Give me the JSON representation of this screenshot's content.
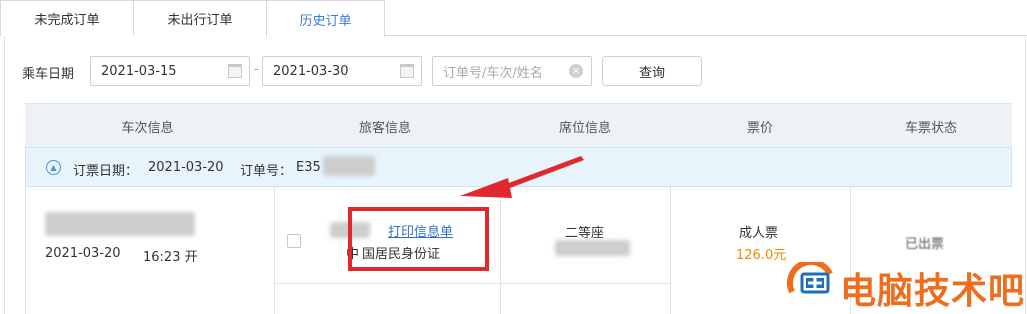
{
  "tabs": [
    {
      "label": "未完成订单"
    },
    {
      "label": "未出行订单"
    },
    {
      "label": "历史订单",
      "active": true
    }
  ],
  "filter": {
    "date_label": "乘车日期",
    "date_from": "2021-03-15",
    "date_sep": "-",
    "date_to": "2021-03-30",
    "search_placeholder": "订单号/车次/姓名",
    "query_button": "查询"
  },
  "table": {
    "headers": [
      "车次信息",
      "旅客信息",
      "席位信息",
      "票价",
      "车票状态"
    ]
  },
  "order": {
    "booking_date_label": "订票日期：",
    "booking_date": "2021-03-20",
    "order_no_label": "订单号：",
    "order_no_visible": "E35"
  },
  "row": {
    "travel_date": "2021-03-20",
    "depart_time": "16:23 开",
    "print_link": "打印信息单",
    "id_type": "国居民身份证",
    "id_prefix": "中",
    "seat_class": "二等座",
    "ticket_type": "成人票",
    "price": "126.0元",
    "status": "已出票"
  },
  "watermark": {
    "text": "电脑技术吧"
  },
  "colors": {
    "accent_blue": "#3a7bd5",
    "price_orange": "#f08a00",
    "annotation_red": "#e0282e",
    "logo_orange": "#ef6d1c"
  }
}
